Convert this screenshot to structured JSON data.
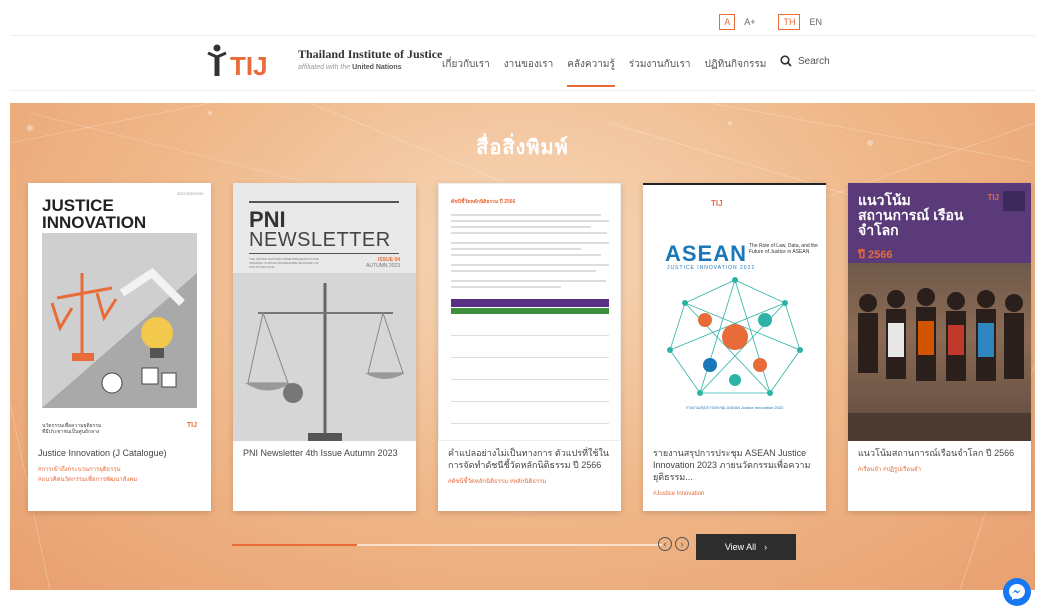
{
  "utility": {
    "font_small": "A",
    "font_large": "A+",
    "lang_th": "TH",
    "lang_en": "EN"
  },
  "brand": {
    "logo_text": "TIJ",
    "org_name": "Thailand Institute of Justice",
    "affiliation_prefix": "affiliated with the",
    "affiliation_un": "United Nations",
    "accent_color": "#e86b3a"
  },
  "nav": {
    "items": [
      {
        "label": "เกี่ยวกับเรา"
      },
      {
        "label": "งานของเรา"
      },
      {
        "label": "คลังความรู้"
      },
      {
        "label": "ร่วมงานกับเรา"
      },
      {
        "label": "ปฏิทินกิจกรรม"
      }
    ],
    "active_index": 2
  },
  "search": {
    "label": "Search",
    "icon": "search-icon"
  },
  "section": {
    "title": "สื่อสิ่งพิมพ์"
  },
  "cards": [
    {
      "title": "Justice Innovation (J Catalogue)",
      "tags": [
        "#การเข้าถึงกระบวนการยุติธรรม",
        "#แนวคิดนวัตกรรมเพื่อการพัฒนาสังคม"
      ],
      "cover": {
        "heading_1": "JUSTICE",
        "heading_2": "INNOVATION",
        "edition": "2023 EDITION",
        "footer_1": "นวัตกรรมเพื่อความยุติธรรม",
        "footer_2": "ที่มีประชาชนเป็นศูนย์กลาง",
        "logo": "TIJ"
      }
    },
    {
      "title": "PNI Newsletter 4th Issue Autumn 2023",
      "tags": [],
      "cover": {
        "heading_1": "PNI",
        "heading_2": "NEWSLETTER",
        "small": "THE UNITED NATIONS CRIME PREVENTION AND CRIMINAL JUSTICE PROGRAMME NETWORK OF INSTITUTES (PNI)",
        "issue": "ISSUE 04",
        "season": "AUTUMN 2023"
      }
    },
    {
      "title": "คำแปลอย่างไม่เป็นทางการ ตัวแปรที่ใช้ในการจัดทำดัชนีชี้วัดหลักนิติธรรม ปี 2566",
      "tags": [
        "#ดัชนีชี้วัดหลักนิติธรรม",
        "#หลักนิติธรรม"
      ],
      "cover": {
        "heading": "ดัชนีชี้วัดหลักนิติธรรม ปี 2566"
      }
    },
    {
      "title": "รายงานสรุปการประชุม ASEAN Justice Innovation 2023 ภายนวัตกรรมเพื่อความยุติธรรม...",
      "tags": [
        "#Justice Innovation"
      ],
      "cover": {
        "heading": "ASEAN",
        "subheading": "JUSTICE INNOVATION",
        "year": "2022",
        "tagline": "The Role of Law, Data, and the Future of Justice in ASEAN",
        "logo": "TIJ",
        "caption": "รายงานสรุปการประชุม ASEAN Justice Innovation 2022"
      }
    },
    {
      "title": "แนวโน้มสถานการณ์เรือนจำโลก ปี 2566",
      "tags": [
        "#เรือนจำ",
        "#ปฏิรูปเรือนจำ"
      ],
      "cover": {
        "heading": "แนวโน้ม สถานการณ์ เรือนจำโลก",
        "year": "ปี 2566",
        "logo": "TIJ"
      }
    }
  ],
  "slider": {
    "progress": 0.29,
    "view_all": "View All"
  }
}
